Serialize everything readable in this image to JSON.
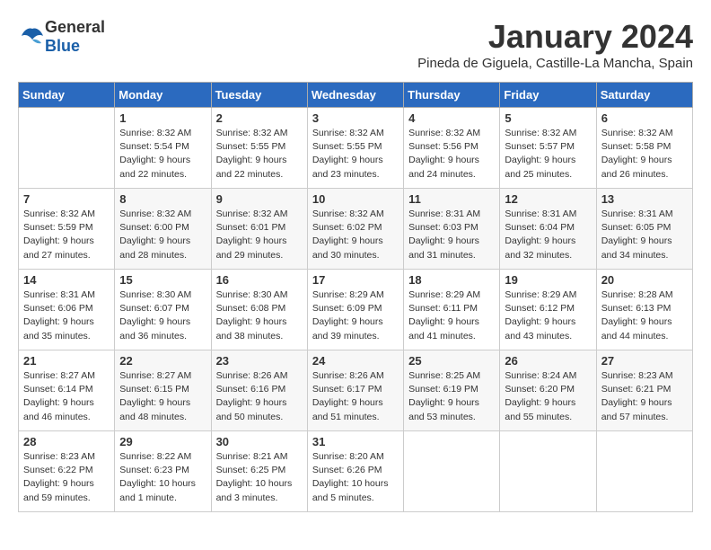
{
  "header": {
    "logo_general": "General",
    "logo_blue": "Blue",
    "title": "January 2024",
    "subtitle": "Pineda de Giguela, Castille-La Mancha, Spain"
  },
  "calendar": {
    "weekdays": [
      "Sunday",
      "Monday",
      "Tuesday",
      "Wednesday",
      "Thursday",
      "Friday",
      "Saturday"
    ],
    "weeks": [
      [
        {
          "day": "",
          "detail": ""
        },
        {
          "day": "1",
          "detail": "Sunrise: 8:32 AM\nSunset: 5:54 PM\nDaylight: 9 hours\nand 22 minutes."
        },
        {
          "day": "2",
          "detail": "Sunrise: 8:32 AM\nSunset: 5:55 PM\nDaylight: 9 hours\nand 22 minutes."
        },
        {
          "day": "3",
          "detail": "Sunrise: 8:32 AM\nSunset: 5:55 PM\nDaylight: 9 hours\nand 23 minutes."
        },
        {
          "day": "4",
          "detail": "Sunrise: 8:32 AM\nSunset: 5:56 PM\nDaylight: 9 hours\nand 24 minutes."
        },
        {
          "day": "5",
          "detail": "Sunrise: 8:32 AM\nSunset: 5:57 PM\nDaylight: 9 hours\nand 25 minutes."
        },
        {
          "day": "6",
          "detail": "Sunrise: 8:32 AM\nSunset: 5:58 PM\nDaylight: 9 hours\nand 26 minutes."
        }
      ],
      [
        {
          "day": "7",
          "detail": "Sunrise: 8:32 AM\nSunset: 5:59 PM\nDaylight: 9 hours\nand 27 minutes."
        },
        {
          "day": "8",
          "detail": "Sunrise: 8:32 AM\nSunset: 6:00 PM\nDaylight: 9 hours\nand 28 minutes."
        },
        {
          "day": "9",
          "detail": "Sunrise: 8:32 AM\nSunset: 6:01 PM\nDaylight: 9 hours\nand 29 minutes."
        },
        {
          "day": "10",
          "detail": "Sunrise: 8:32 AM\nSunset: 6:02 PM\nDaylight: 9 hours\nand 30 minutes."
        },
        {
          "day": "11",
          "detail": "Sunrise: 8:31 AM\nSunset: 6:03 PM\nDaylight: 9 hours\nand 31 minutes."
        },
        {
          "day": "12",
          "detail": "Sunrise: 8:31 AM\nSunset: 6:04 PM\nDaylight: 9 hours\nand 32 minutes."
        },
        {
          "day": "13",
          "detail": "Sunrise: 8:31 AM\nSunset: 6:05 PM\nDaylight: 9 hours\nand 34 minutes."
        }
      ],
      [
        {
          "day": "14",
          "detail": "Sunrise: 8:31 AM\nSunset: 6:06 PM\nDaylight: 9 hours\nand 35 minutes."
        },
        {
          "day": "15",
          "detail": "Sunrise: 8:30 AM\nSunset: 6:07 PM\nDaylight: 9 hours\nand 36 minutes."
        },
        {
          "day": "16",
          "detail": "Sunrise: 8:30 AM\nSunset: 6:08 PM\nDaylight: 9 hours\nand 38 minutes."
        },
        {
          "day": "17",
          "detail": "Sunrise: 8:29 AM\nSunset: 6:09 PM\nDaylight: 9 hours\nand 39 minutes."
        },
        {
          "day": "18",
          "detail": "Sunrise: 8:29 AM\nSunset: 6:11 PM\nDaylight: 9 hours\nand 41 minutes."
        },
        {
          "day": "19",
          "detail": "Sunrise: 8:29 AM\nSunset: 6:12 PM\nDaylight: 9 hours\nand 43 minutes."
        },
        {
          "day": "20",
          "detail": "Sunrise: 8:28 AM\nSunset: 6:13 PM\nDaylight: 9 hours\nand 44 minutes."
        }
      ],
      [
        {
          "day": "21",
          "detail": "Sunrise: 8:27 AM\nSunset: 6:14 PM\nDaylight: 9 hours\nand 46 minutes."
        },
        {
          "day": "22",
          "detail": "Sunrise: 8:27 AM\nSunset: 6:15 PM\nDaylight: 9 hours\nand 48 minutes."
        },
        {
          "day": "23",
          "detail": "Sunrise: 8:26 AM\nSunset: 6:16 PM\nDaylight: 9 hours\nand 50 minutes."
        },
        {
          "day": "24",
          "detail": "Sunrise: 8:26 AM\nSunset: 6:17 PM\nDaylight: 9 hours\nand 51 minutes."
        },
        {
          "day": "25",
          "detail": "Sunrise: 8:25 AM\nSunset: 6:19 PM\nDaylight: 9 hours\nand 53 minutes."
        },
        {
          "day": "26",
          "detail": "Sunrise: 8:24 AM\nSunset: 6:20 PM\nDaylight: 9 hours\nand 55 minutes."
        },
        {
          "day": "27",
          "detail": "Sunrise: 8:23 AM\nSunset: 6:21 PM\nDaylight: 9 hours\nand 57 minutes."
        }
      ],
      [
        {
          "day": "28",
          "detail": "Sunrise: 8:23 AM\nSunset: 6:22 PM\nDaylight: 9 hours\nand 59 minutes."
        },
        {
          "day": "29",
          "detail": "Sunrise: 8:22 AM\nSunset: 6:23 PM\nDaylight: 10 hours\nand 1 minute."
        },
        {
          "day": "30",
          "detail": "Sunrise: 8:21 AM\nSunset: 6:25 PM\nDaylight: 10 hours\nand 3 minutes."
        },
        {
          "day": "31",
          "detail": "Sunrise: 8:20 AM\nSunset: 6:26 PM\nDaylight: 10 hours\nand 5 minutes."
        },
        {
          "day": "",
          "detail": ""
        },
        {
          "day": "",
          "detail": ""
        },
        {
          "day": "",
          "detail": ""
        }
      ]
    ]
  }
}
